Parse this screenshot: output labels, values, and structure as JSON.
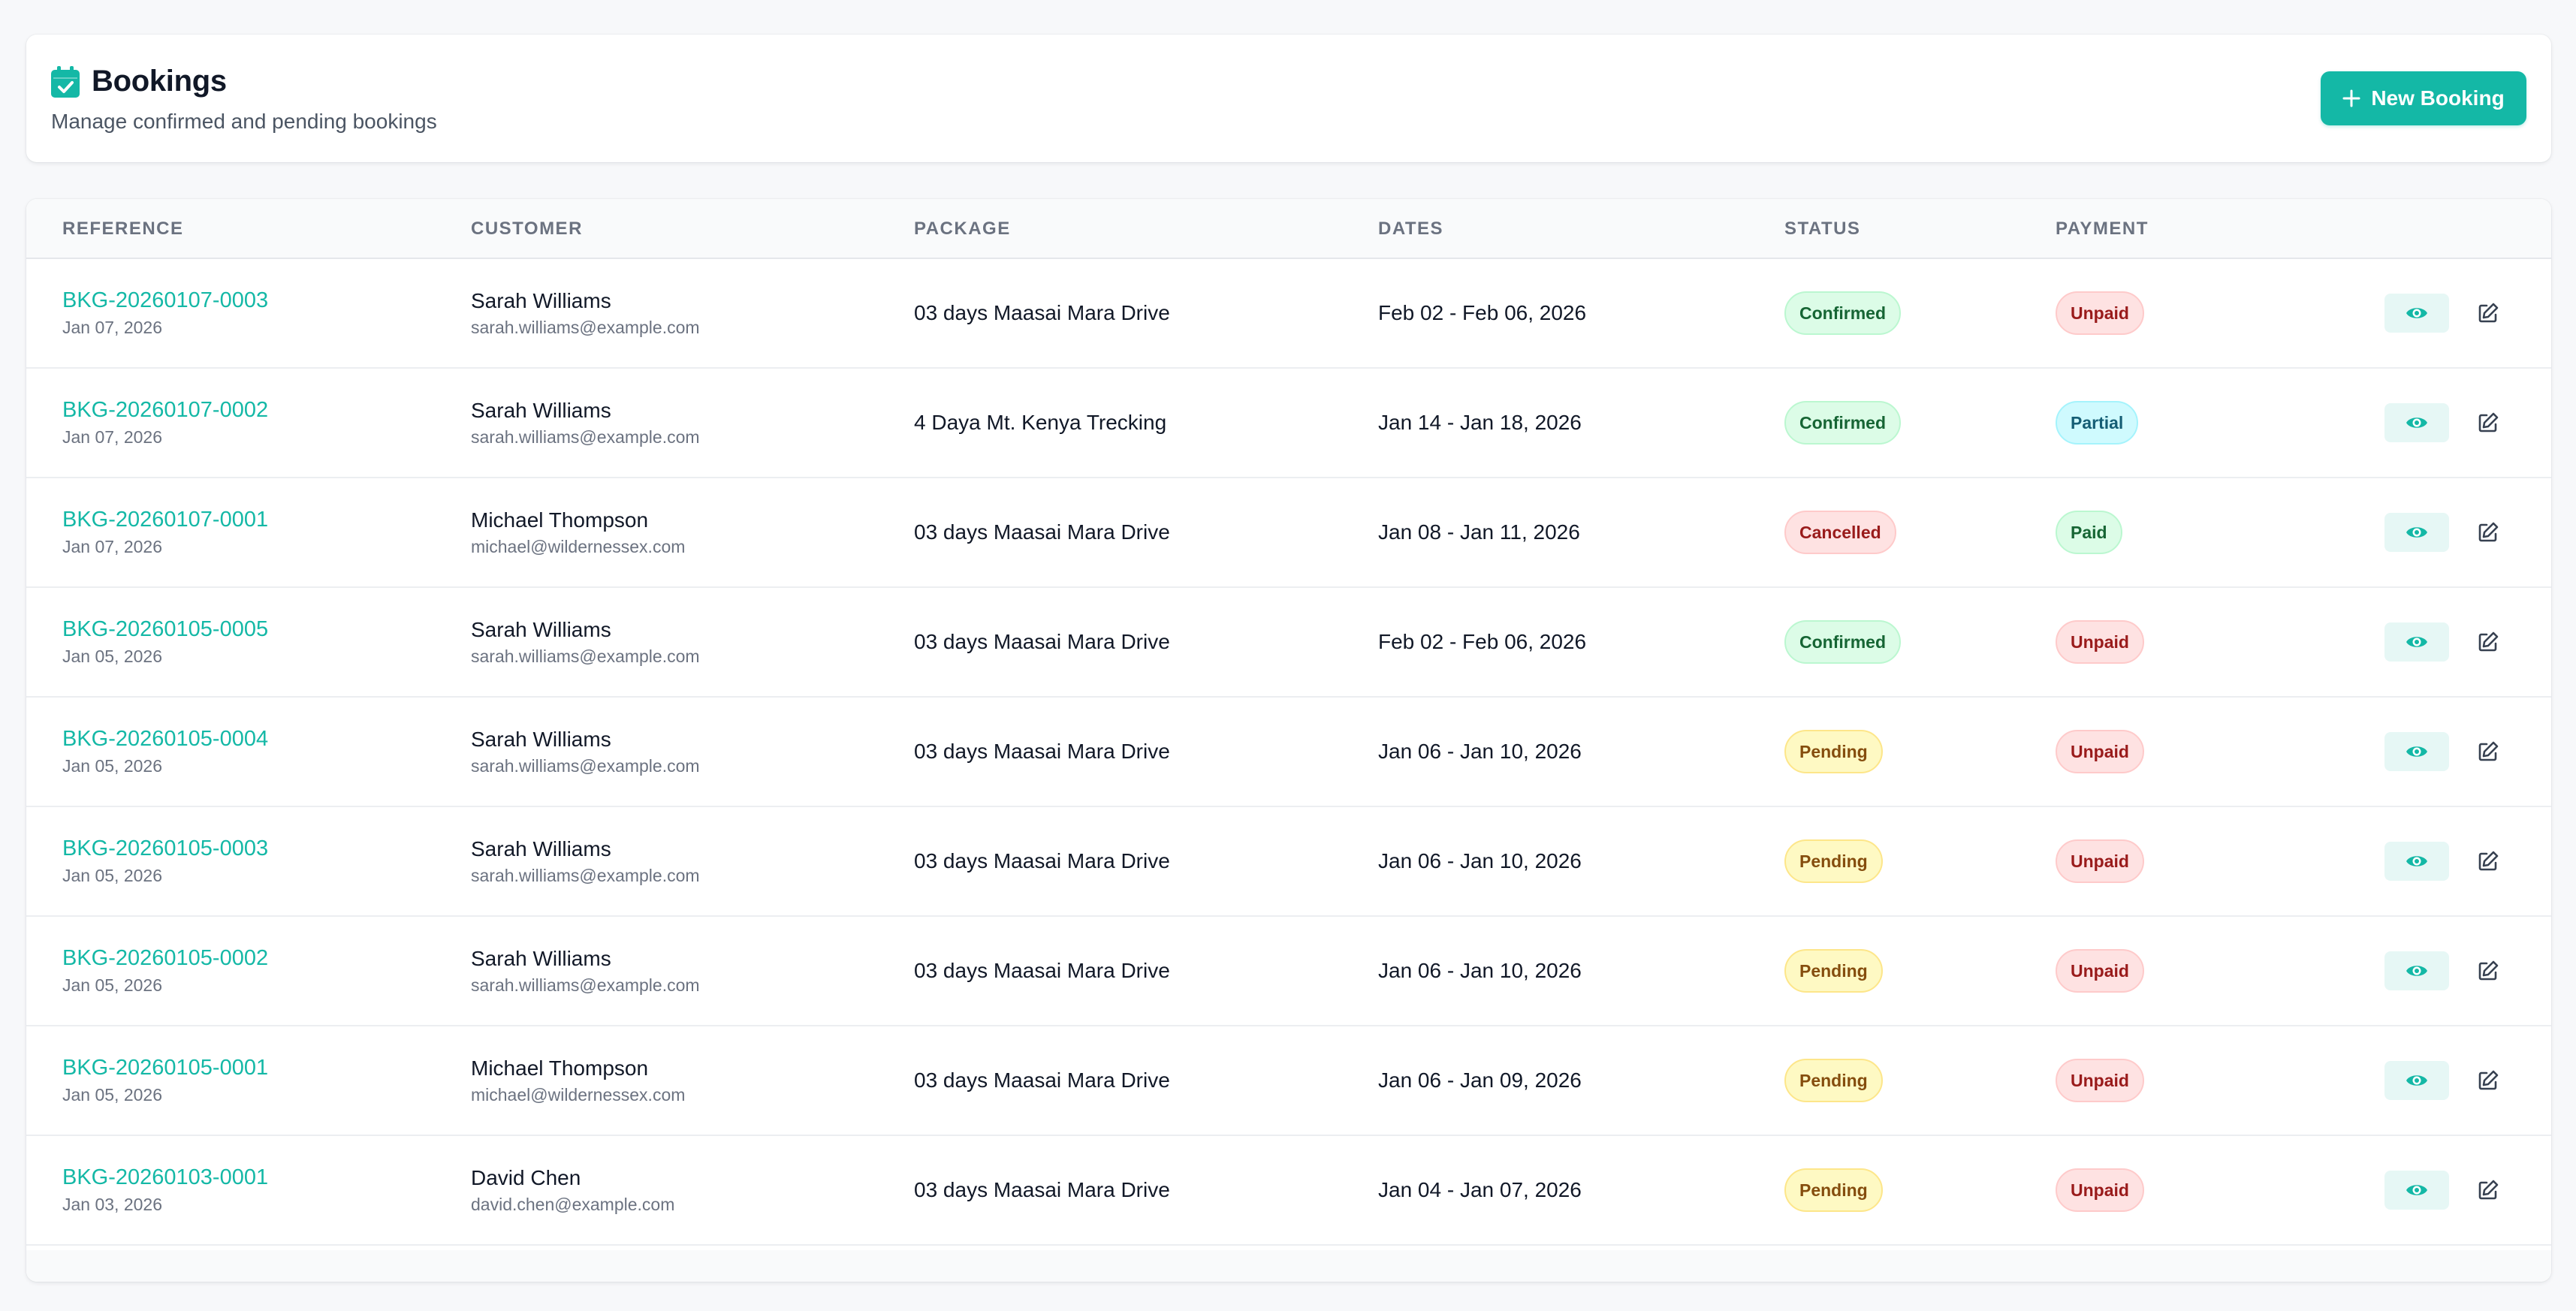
{
  "header": {
    "title": "Bookings",
    "subtitle": "Manage confirmed and pending bookings",
    "new_button_label": "New Booking",
    "accent_color": "#14b8a6"
  },
  "table": {
    "columns": [
      "REFERENCE",
      "CUSTOMER",
      "PACKAGE",
      "DATES",
      "STATUS",
      "PAYMENT"
    ],
    "rows": [
      {
        "reference": "BKG-20260107-0003",
        "created": "Jan 07, 2026",
        "customer": "Sarah Williams",
        "email": "sarah.williams@example.com",
        "package": "03 days Maasai Mara Drive",
        "dates": "Feb 02 - Feb 06, 2026",
        "status": "Confirmed",
        "payment": "Unpaid"
      },
      {
        "reference": "BKG-20260107-0002",
        "created": "Jan 07, 2026",
        "customer": "Sarah Williams",
        "email": "sarah.williams@example.com",
        "package": "4 Daya Mt. Kenya Trecking",
        "dates": "Jan 14 - Jan 18, 2026",
        "status": "Confirmed",
        "payment": "Partial"
      },
      {
        "reference": "BKG-20260107-0001",
        "created": "Jan 07, 2026",
        "customer": "Michael Thompson",
        "email": "michael@wildernessex.com",
        "package": "03 days Maasai Mara Drive",
        "dates": "Jan 08 - Jan 11, 2026",
        "status": "Cancelled",
        "payment": "Paid"
      },
      {
        "reference": "BKG-20260105-0005",
        "created": "Jan 05, 2026",
        "customer": "Sarah Williams",
        "email": "sarah.williams@example.com",
        "package": "03 days Maasai Mara Drive",
        "dates": "Feb 02 - Feb 06, 2026",
        "status": "Confirmed",
        "payment": "Unpaid"
      },
      {
        "reference": "BKG-20260105-0004",
        "created": "Jan 05, 2026",
        "customer": "Sarah Williams",
        "email": "sarah.williams@example.com",
        "package": "03 days Maasai Mara Drive",
        "dates": "Jan 06 - Jan 10, 2026",
        "status": "Pending",
        "payment": "Unpaid"
      },
      {
        "reference": "BKG-20260105-0003",
        "created": "Jan 05, 2026",
        "customer": "Sarah Williams",
        "email": "sarah.williams@example.com",
        "package": "03 days Maasai Mara Drive",
        "dates": "Jan 06 - Jan 10, 2026",
        "status": "Pending",
        "payment": "Unpaid"
      },
      {
        "reference": "BKG-20260105-0002",
        "created": "Jan 05, 2026",
        "customer": "Sarah Williams",
        "email": "sarah.williams@example.com",
        "package": "03 days Maasai Mara Drive",
        "dates": "Jan 06 - Jan 10, 2026",
        "status": "Pending",
        "payment": "Unpaid"
      },
      {
        "reference": "BKG-20260105-0001",
        "created": "Jan 05, 2026",
        "customer": "Michael Thompson",
        "email": "michael@wildernessex.com",
        "package": "03 days Maasai Mara Drive",
        "dates": "Jan 06 - Jan 09, 2026",
        "status": "Pending",
        "payment": "Unpaid"
      },
      {
        "reference": "BKG-20260103-0001",
        "created": "Jan 03, 2026",
        "customer": "David Chen",
        "email": "david.chen@example.com",
        "package": "03 days Maasai Mara Drive",
        "dates": "Jan 04 - Jan 07, 2026",
        "status": "Pending",
        "payment": "Unpaid"
      }
    ]
  },
  "icons": {
    "title": "calendar-check-icon",
    "new_button": "plus-icon",
    "view_action": "eye-icon",
    "edit_action": "edit-icon"
  }
}
